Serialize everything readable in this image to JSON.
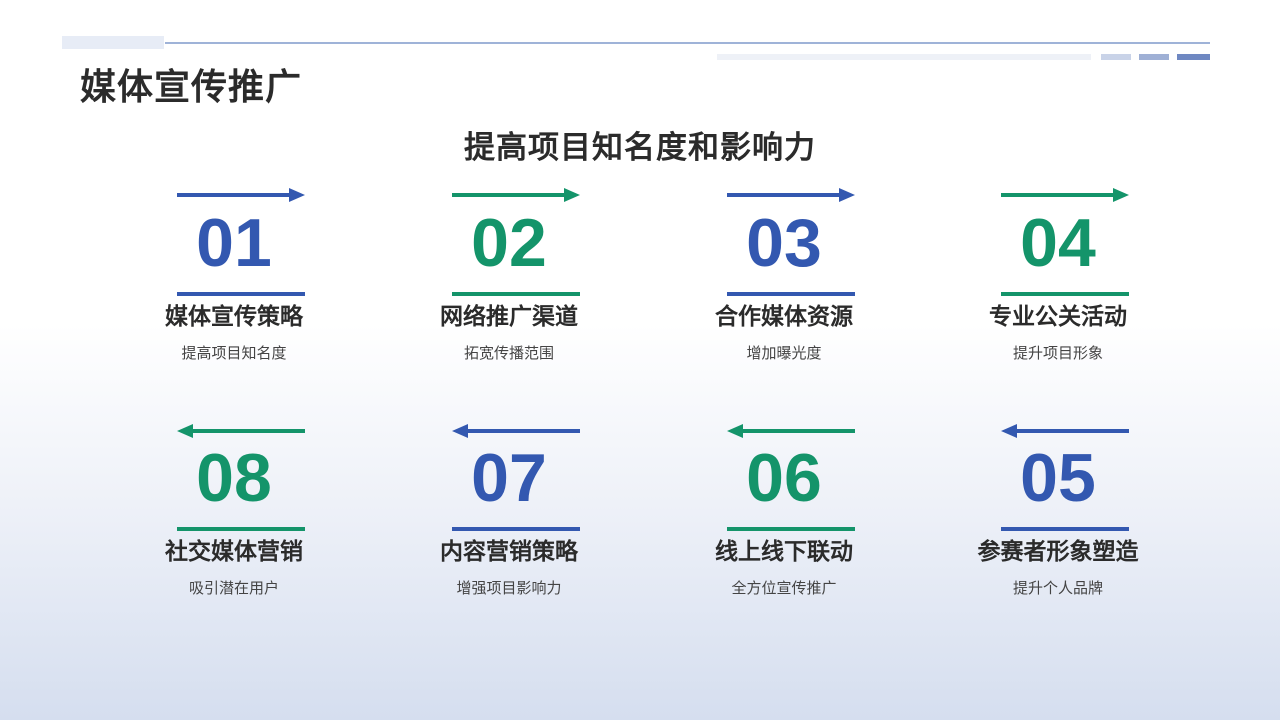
{
  "header": {
    "title": "媒体宣传推广",
    "subtitle": "提高项目知名度和影响力"
  },
  "colors": {
    "blue": "#3358b0",
    "green": "#14946a"
  },
  "steps": [
    {
      "number": "01",
      "title": "媒体宣传策略",
      "desc": "提高项目知名度",
      "color": "blue",
      "arrow": "right-arrow-icon"
    },
    {
      "number": "02",
      "title": "网络推广渠道",
      "desc": "拓宽传播范围",
      "color": "green",
      "arrow": "right-arrow-icon"
    },
    {
      "number": "03",
      "title": "合作媒体资源",
      "desc": "增加曝光度",
      "color": "blue",
      "arrow": "right-arrow-icon"
    },
    {
      "number": "04",
      "title": "专业公关活动",
      "desc": "提升项目形象",
      "color": "green",
      "arrow": "right-arrow-icon"
    },
    {
      "number": "05",
      "title": "参赛者形象塑造",
      "desc": "提升个人品牌",
      "color": "blue",
      "arrow": "left-arrow-icon"
    },
    {
      "number": "06",
      "title": "线上线下联动",
      "desc": "全方位宣传推广",
      "color": "green",
      "arrow": "left-arrow-icon"
    },
    {
      "number": "07",
      "title": "内容营销策略",
      "desc": "增强项目影响力",
      "color": "blue",
      "arrow": "left-arrow-icon"
    },
    {
      "number": "08",
      "title": "社交媒体营销",
      "desc": "吸引潜在用户",
      "color": "green",
      "arrow": "left-arrow-icon"
    }
  ]
}
